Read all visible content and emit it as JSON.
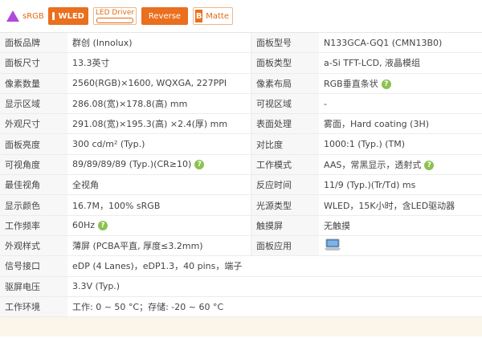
{
  "badges": [
    {
      "name": "srgb-badge",
      "label": "sRGB"
    },
    {
      "name": "wled-badge",
      "label": "WLED"
    },
    {
      "name": "led-driver-badge",
      "label": "LED Driver"
    },
    {
      "name": "reverse-badge",
      "label": "Reverse"
    },
    {
      "name": "matte-badge",
      "label": "Matte",
      "icon_letter": "B"
    }
  ],
  "rows": [
    {
      "l1": "面板品牌",
      "v1": "群创 (Innolux)",
      "l2": "面板型号",
      "v2": "N133GCA-GQ1 (CMN13B0)"
    },
    {
      "l1": "面板尺寸",
      "v1": "13.3英寸",
      "l2": "面板类型",
      "v2": "a-Si TFT-LCD, 液晶模组"
    },
    {
      "l1": "像素数量",
      "v1": "2560(RGB)×1600, WQXGA, 227PPI",
      "l2": "像素布局",
      "v2": "RGB垂直条状"
    },
    {
      "l1": "显示区域",
      "v1": "286.08(宽)×178.8(高) mm",
      "l2": "可视区域",
      "v2": "-"
    },
    {
      "l1": "外观尺寸",
      "v1": "291.08(宽)×195.3(高) ×2.4(厚) mm",
      "l2": "表面处理",
      "v2": "雾面，Hard coating (3H)"
    },
    {
      "l1": "面板亮度",
      "v1": "300 cd/m² (Typ.)",
      "l2": "对比度",
      "v2": "1000:1 (Typ.) (TM)"
    },
    {
      "l1": "可视角度",
      "v1": "89/89/89/89 (Typ.)(CR≥10)",
      "l2": "工作模式",
      "v2": "AAS，常黑显示，透射式"
    },
    {
      "l1": "最佳视角",
      "v1": "全视角",
      "l2": "反应时间",
      "v2": "11/9 (Typ.)(Tr/Td) ms"
    },
    {
      "l1": "显示颜色",
      "v1": "16.7M，100% sRGB",
      "l2": "光源类型",
      "v2": "WLED，15K小时，含LED驱动器"
    },
    {
      "l1": "工作频率",
      "v1": "60Hz",
      "l2": "触摸屏",
      "v2": "无触摸"
    },
    {
      "l1": "外观样式",
      "v1": "薄屏 (PCBA平直, 厚度≤3.2mm)",
      "l2": "面板应用",
      "v2": ""
    },
    {
      "l1": "信号接口",
      "v1": "eDP (4 Lanes)，eDP1.3，40 pins，端子",
      "l2": "",
      "v2": ""
    },
    {
      "l1": "驱屏电压",
      "v1": "3.3V (Typ.)",
      "l2": "",
      "v2": ""
    },
    {
      "l1": "工作环境",
      "v1": "工作: 0 ~ 50 °C；存储: -20 ~ 60 °C",
      "l2": "",
      "v2": ""
    }
  ],
  "help_symbol": "?",
  "colors": {
    "accent": "#ea6f1e",
    "help": "#8cc152",
    "label_bg": "#f7f7f7"
  }
}
